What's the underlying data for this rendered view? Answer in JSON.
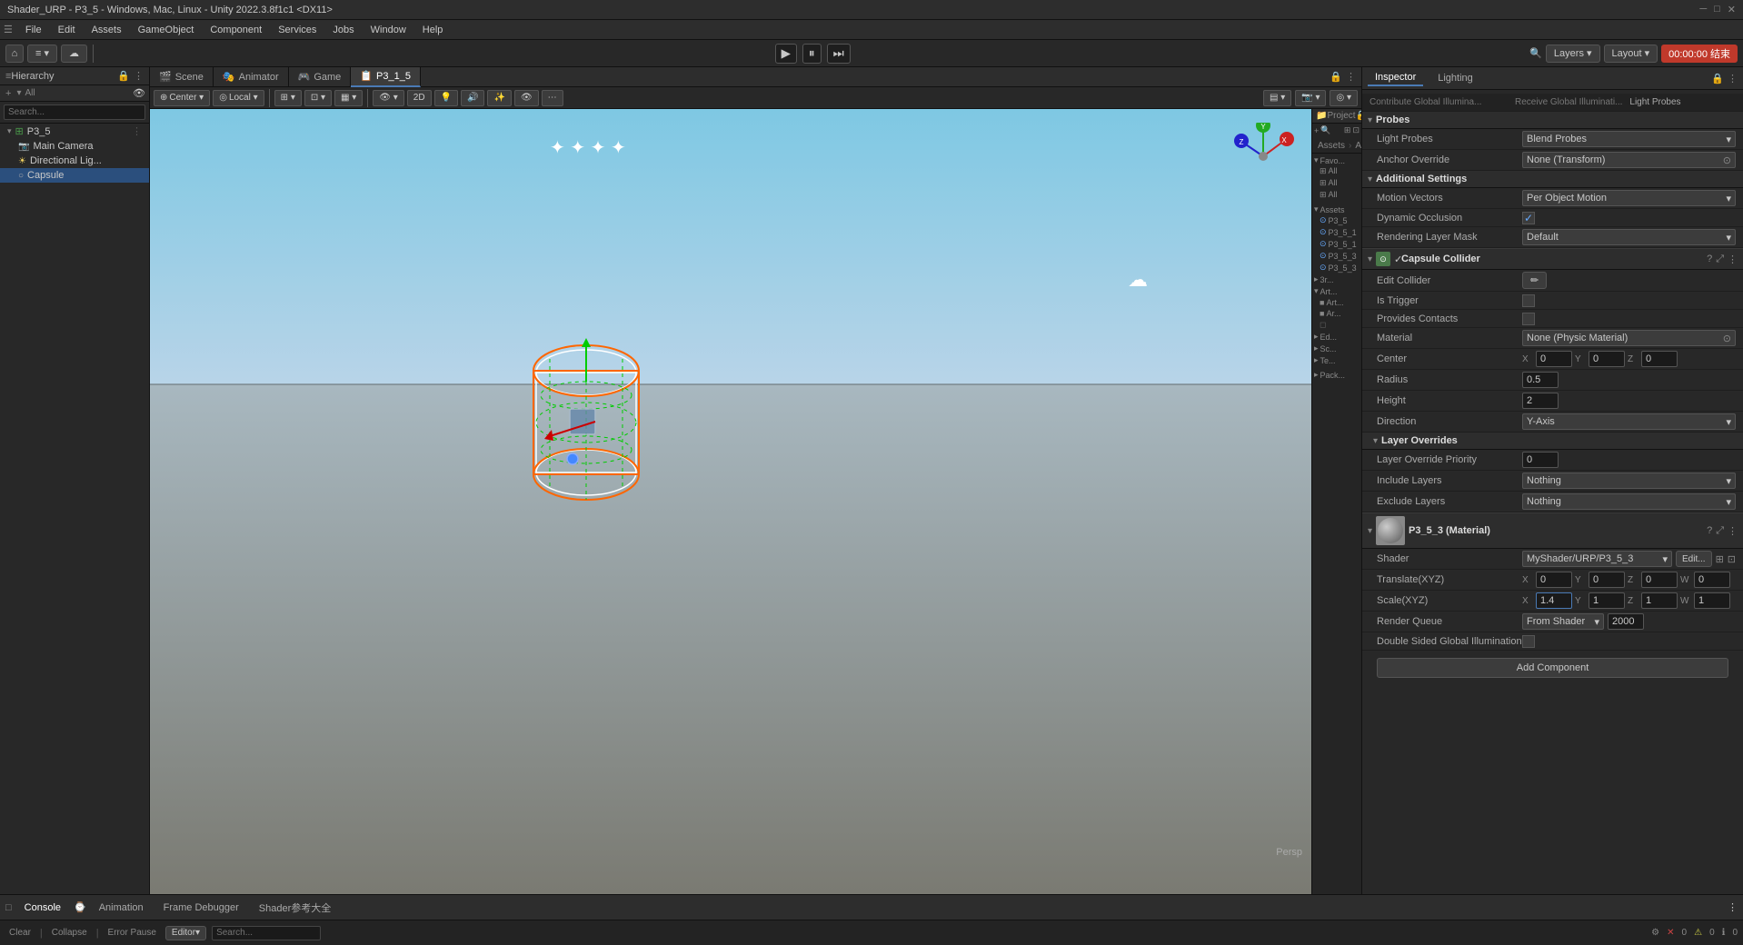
{
  "window": {
    "title": "Shader_URP - P3_5 - Windows, Mac, Linux - Unity 2022.3.8f1c1 <DX11>"
  },
  "menubar": {
    "items": [
      "File",
      "Edit",
      "Assets",
      "GameObject",
      "Component",
      "Services",
      "Jobs",
      "Window",
      "Help"
    ]
  },
  "toolbar": {
    "play": "▶",
    "pause": "⏸",
    "step": "⏭",
    "layers_label": "Layers",
    "layout_label": "Layout",
    "timer": "00:00:00 结束"
  },
  "hierarchy": {
    "title": "Hierarchy",
    "search_placeholder": "All",
    "items": [
      {
        "label": "P3_5",
        "indent": 0,
        "expanded": true,
        "selected": false
      },
      {
        "label": "Main Camera",
        "indent": 1,
        "selected": false
      },
      {
        "label": "Directional Light",
        "indent": 1,
        "selected": false
      },
      {
        "label": "Capsule",
        "indent": 1,
        "selected": true
      }
    ]
  },
  "view_tabs": [
    {
      "label": "Scene",
      "icon": "🎬",
      "active": false
    },
    {
      "label": "Animator",
      "icon": "🎭",
      "active": false
    },
    {
      "label": "Game",
      "icon": "🎮",
      "active": false
    },
    {
      "label": "P3_1_5",
      "icon": "📋",
      "active": true
    }
  ],
  "scene_view": {
    "persp_label": "Persp",
    "center_dropdown": "Center",
    "local_dropdown": "Local"
  },
  "project": {
    "title": "Project",
    "items": [
      {
        "label": "Favorites",
        "expanded": true
      },
      {
        "label": "Assets",
        "expanded": true
      },
      {
        "label": "Arts",
        "expanded": false
      }
    ],
    "assets_path": "Assets › Arts",
    "files": [
      "P3_5",
      "P3_5_1",
      "P3_5_1",
      "P3_5_3",
      "P3_5_3"
    ]
  },
  "inspector": {
    "title": "Inspector",
    "lighting_tab": "Lighting",
    "sections": {
      "contribute_global": "Contribute Global Illumina...",
      "receive_global": "Receive Global Illuminati...",
      "probes_label": "Light Probes"
    },
    "probes": {
      "section_title": "Probes",
      "light_probes_label": "Light Probes",
      "light_probes_value": "Blend Probes",
      "anchor_override_label": "Anchor Override",
      "anchor_override_value": "None (Transform)"
    },
    "additional_settings": {
      "section_title": "Additional Settings",
      "motion_vectors_label": "Motion Vectors",
      "motion_vectors_value": "Per Object Motion",
      "dynamic_occlusion_label": "Dynamic Occlusion",
      "dynamic_occlusion_checked": true,
      "rendering_layer_mask_label": "Rendering Layer Mask",
      "rendering_layer_mask_value": "Default"
    },
    "capsule_collider": {
      "component_title": "Capsule Collider",
      "edit_collider_label": "Edit Collider",
      "is_trigger_label": "Is Trigger",
      "provides_contacts_label": "Provides Contacts",
      "material_label": "Material",
      "material_value": "None (Physic Material)",
      "center_label": "Center",
      "center_x": "0",
      "center_y": "0",
      "center_z": "0",
      "radius_label": "Radius",
      "radius_value": "0.5",
      "height_label": "Height",
      "height_value": "2",
      "direction_label": "Direction",
      "direction_value": "Y-Axis"
    },
    "layer_overrides": {
      "section_title": "Layer Overrides",
      "priority_label": "Layer Override Priority",
      "priority_value": "0",
      "include_label": "Include Layers",
      "include_value": "Nothing",
      "exclude_label": "Exclude Layers",
      "exclude_value": "Nothing"
    },
    "material_section": {
      "name": "P3_5_3 (Material)",
      "shader_label": "Shader",
      "shader_value": "MyShader/URP/P3_5_3",
      "edit_btn": "Edit...",
      "translate_label": "Translate(XYZ)",
      "tx": "0",
      "ty": "0",
      "tz": "0",
      "tw": "0",
      "scale_label": "Scale(XYZ)",
      "sx": "1.4",
      "sy": "1",
      "sz": "1",
      "sw": "1",
      "render_queue_label": "Render Queue",
      "render_queue_source": "From Shader",
      "render_queue_value": "2000",
      "double_sided_label": "Double Sided Global Illumination"
    },
    "add_component_btn": "Add Component"
  },
  "console": {
    "tabs": [
      "Console",
      "Animation",
      "Frame Debugger",
      "Shader参考大全"
    ],
    "active_tab": "Console",
    "clear_btn": "Clear",
    "collapse_btn": "Collapse",
    "error_pause_btn": "Error Pause",
    "editor_dropdown": "Editor",
    "errors": "0",
    "warnings": "0",
    "messages": "0"
  },
  "icons": {
    "arrow_right": "▶",
    "arrow_down": "▼",
    "triangle_right": "▸",
    "triangle_down": "▾",
    "close": "✕",
    "gear": "⚙",
    "lock": "🔒",
    "expand": "⤢",
    "folder": "📁",
    "checkmark": "✓",
    "chevron_down": "▾",
    "dot": "•",
    "pencil": "✏",
    "box": "□",
    "circle": "○",
    "diamond": "◇",
    "plus": "+",
    "minus": "-",
    "question": "?",
    "star": "★",
    "eye": "👁",
    "camera": "📷"
  }
}
